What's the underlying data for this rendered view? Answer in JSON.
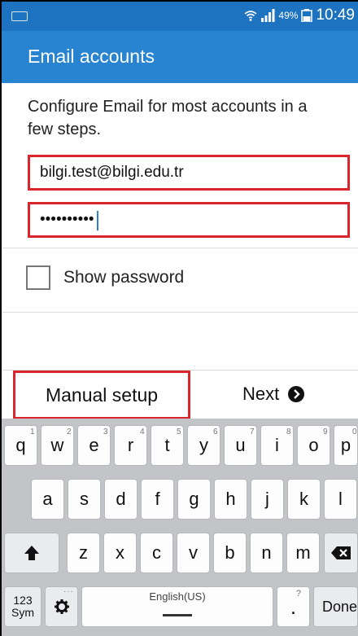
{
  "status_bar": {
    "battery_percent": "49%",
    "time": "10:49"
  },
  "app_bar": {
    "title": "Email accounts"
  },
  "form": {
    "description": "Configure Email for most accounts in a few steps.",
    "email_value": "bilgi.test@bilgi.edu.tr",
    "password_value": "1234567890",
    "show_password_label": "Show password",
    "show_password_checked": false
  },
  "actions": {
    "manual_setup_label": "Manual setup",
    "next_label": "Next"
  },
  "keyboard": {
    "row1": [
      {
        "key": "q",
        "num": "1"
      },
      {
        "key": "w",
        "num": "2"
      },
      {
        "key": "e",
        "num": "3"
      },
      {
        "key": "r",
        "num": "4"
      },
      {
        "key": "t",
        "num": "5"
      },
      {
        "key": "y",
        "num": "6"
      },
      {
        "key": "u",
        "num": "7"
      },
      {
        "key": "i",
        "num": "8"
      },
      {
        "key": "o",
        "num": "9"
      },
      {
        "key": "p",
        "num": "0"
      }
    ],
    "row2": [
      "a",
      "s",
      "d",
      "f",
      "g",
      "h",
      "j",
      "k",
      "l"
    ],
    "row3": [
      "z",
      "x",
      "c",
      "v",
      "b",
      "n",
      "m"
    ],
    "sym_top": "123",
    "sym_bottom": "Sym",
    "language_label": "English(US)",
    "period": ".",
    "done_label": "Done"
  },
  "colors": {
    "status_bar": "#1d73bf",
    "app_bar": "#2884d0",
    "highlight_border": "#d9262c",
    "keyboard_background": "#c2c4c8"
  },
  "icons": {
    "wifi": "wifi-icon",
    "signal": "signal-icon",
    "battery": "battery-icon",
    "next": "arrow-circle-right-icon",
    "shift": "shift-arrow-icon",
    "backspace": "backspace-icon",
    "settings": "gear-icon"
  }
}
